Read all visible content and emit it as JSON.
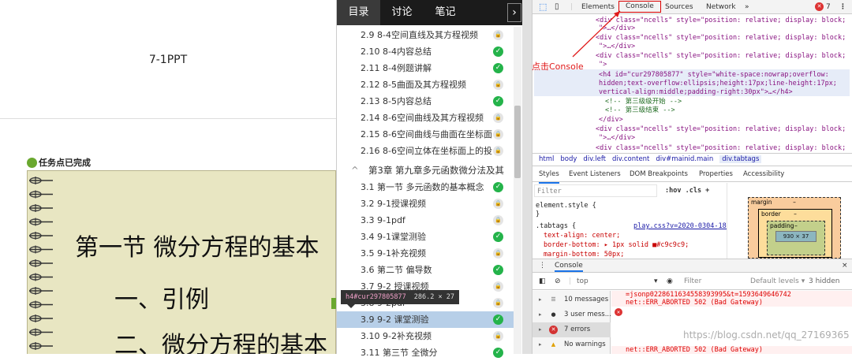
{
  "left": {
    "ppt_title": "7-1PPT",
    "task_status": "任务点已完成",
    "slide": {
      "heading": "第一节 微分方程的基本",
      "sub1": "一、引例",
      "sub2": "二、微分方程的基本"
    }
  },
  "middle": {
    "tabs": [
      "目录",
      "讨论",
      "笔记"
    ],
    "arrow": "›",
    "items": [
      {
        "label": "2.9 8-4空间直线及其方程视频",
        "status": "lock"
      },
      {
        "label": "2.10 8-4内容总结",
        "status": "done"
      },
      {
        "label": "2.11 8-4例题讲解",
        "status": "done"
      },
      {
        "label": "2.12 8-5曲面及其方程视频",
        "status": "lock"
      },
      {
        "label": "2.13 8-5内容总结",
        "status": "done"
      },
      {
        "label": "2.14 8-6空间曲线及其方程视频",
        "status": "lock"
      },
      {
        "label": "2.15 8-6空间曲线与曲面在坐标面...",
        "status": "lock"
      },
      {
        "label": "2.16 8-6空间立体在坐标面上的投...",
        "status": "lock"
      }
    ],
    "chapter": {
      "arrow": "^",
      "label": "第3章 第九章多元函数微分法及其"
    },
    "items2": [
      {
        "label": "3.1 第一节 多元函数的基本概念",
        "status": "done"
      },
      {
        "label": "3.2 9-1授课视频",
        "status": "lock"
      },
      {
        "label": "3.3 9-1pdf",
        "status": "lock"
      },
      {
        "label": "3.4 9-1课堂测验",
        "status": "done"
      },
      {
        "label": "3.5 9-1补充视频",
        "status": "lock"
      },
      {
        "label": "3.6 第二节 偏导数",
        "status": "done"
      },
      {
        "label": "3.7 9-2 授课视频",
        "status": "lock"
      },
      {
        "label": "3.8 9-2pdf",
        "status": "lock"
      },
      {
        "label": "3.9 9-2 课堂测验",
        "status": "done"
      },
      {
        "label": "3.10 9-2补充视频",
        "status": "lock"
      },
      {
        "label": "3.11 第三节 全微分",
        "status": "done"
      }
    ],
    "tooltip": {
      "tag": "h4#cur297805877",
      "dims": "286.2 × 27"
    }
  },
  "devtools": {
    "tabs": [
      "Elements",
      "Console",
      "Sources",
      "Network",
      "»"
    ],
    "error_count": "7",
    "annotation": "点击Console",
    "elements_lines": [
      "<div class=\"ncells\" style=\"position: relative; display: block;",
      "\">…</div>",
      "<div class=\"ncells\" style=\"position: relative; display: block;",
      "\">…</div>",
      "<div class=\"ncells\" style=\"position: relative; display: block;",
      "\">",
      "<h4 id=\"cur297805877\" style=\"white-space:nowrap;overflow:",
      "hidden;text-overflow:ellipsis;height:17px;line-height:17px;",
      "vertical-align:middle;padding-right:30px\">…</h4>",
      "<!-- 第三级级开始 -->",
      "<!-- 第三级结束 -->",
      "</div>",
      "<div class=\"ncells\" style=\"position: relative; display: block;",
      "\">…</div>",
      "<div class=\"ncells\" style=\"position: relative; display: block;"
    ],
    "breadcrumbs": [
      "html",
      "body",
      "div.left",
      "div.content",
      "div#mainid.main",
      "div.tabtags"
    ],
    "style_tabs": [
      "Styles",
      "Event Listeners",
      "DOM Breakpoints",
      "Properties",
      "Accessibility"
    ],
    "filter_placeholder": "Filter",
    "filter_opts": ":hov .cls +",
    "styles_lines": [
      "element.style {",
      "}",
      ".tabtags {",
      "play.css?v=2020-0304-1848:8",
      "text-align: center;",
      "border-bottom: ▸ 1px solid ■#c9c9c9;",
      "margin-bottom: 50px;"
    ],
    "box_model": {
      "margin": "margin",
      "border": "border",
      "padding": "padding",
      "content": "930 × 37",
      "dash": "–"
    },
    "console_drawer": {
      "dots": "⋮",
      "label": "Console",
      "close": "×"
    },
    "console_bar": {
      "context": "top",
      "filter": "Filter",
      "levels": "Default levels ▾",
      "hidden": "3 hidden"
    },
    "sidebar": [
      {
        "label": "10 messages",
        "icon": "list"
      },
      {
        "label": "3 user mess...",
        "icon": "user"
      },
      {
        "label": "7 errors",
        "icon": "error"
      },
      {
        "label": "No warnings",
        "icon": "warn"
      }
    ],
    "console_lines": [
      "=jsonp0228611634558393995&t=1593649646742",
      "net::ERR_ABORTED 502 (Bad Gateway)",
      "",
      "",
      "",
      "",
      "",
      "net::ERR_ABORTED 502 (Bad Gateway)"
    ],
    "watermark": "https://blog.csdn.net/qq_27169365"
  },
  "colors": {
    "done": "#24b34a",
    "accent": "#1a73e8",
    "error": "#d33333",
    "annotation": "#e01a1a"
  }
}
